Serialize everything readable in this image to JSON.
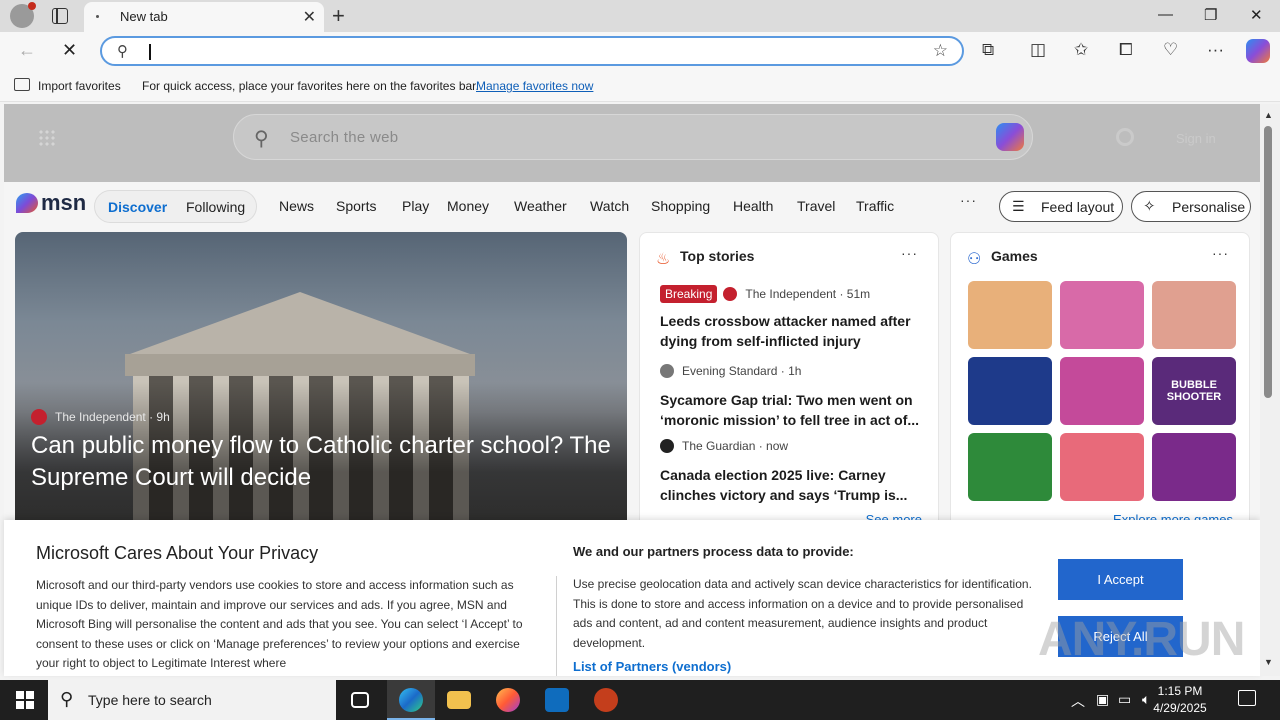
{
  "browser": {
    "tab_title": "New tab",
    "address_value": "",
    "favorites_bar": {
      "import_label": "Import favorites",
      "message": "For quick access, place your favorites here on the favorites bar.",
      "manage_link": "Manage favorites now"
    }
  },
  "msn": {
    "search_placeholder": "Search the web",
    "dim_sign_in": "Sign in",
    "logo_text": "msn",
    "pill": {
      "discover": "Discover",
      "following": "Following"
    },
    "nav_items": [
      "News",
      "Sports",
      "Play",
      "Money",
      "Weather",
      "Watch",
      "Shopping",
      "Health",
      "Travel",
      "Traffic"
    ],
    "more": "···",
    "feed_layout": "Feed layout",
    "personalise": "Personalise"
  },
  "hero": {
    "source": "The Independent · 9h",
    "title": "Can public money flow to Catholic charter school? The Supreme Court will decide"
  },
  "top_stories": {
    "heading": "Top stories",
    "stories": [
      {
        "badge": "Breaking",
        "source": "The Independent · 51m",
        "title": "Leeds crossbow attacker named after dying from self-inflicted injury",
        "logo_color": "#c4202e"
      },
      {
        "badge": "",
        "source": "Evening Standard · 1h",
        "title": "Sycamore Gap trial: Two men went on ‘moronic mission’ to fell tree in act of...",
        "logo_color": "#777777"
      },
      {
        "badge": "",
        "source": "The Guardian · now",
        "title": "Canada election 2025 live: Carney clinches victory and says ‘Trump is...",
        "logo_color": "#222222"
      }
    ],
    "see_more": "See more"
  },
  "games": {
    "heading": "Games",
    "explore": "Explore more games",
    "tiles": [
      {
        "label": "",
        "color": "#e8b07a"
      },
      {
        "label": "",
        "color": "#d86aa8"
      },
      {
        "label": "",
        "color": "#e0a090"
      },
      {
        "label": "",
        "color": "#1e3a8a"
      },
      {
        "label": "",
        "color": "#c44a9a"
      },
      {
        "label": "BUBBLE SHOOTER",
        "color": "#5a2a7a"
      },
      {
        "label": "",
        "color": "#2e8a3a"
      },
      {
        "label": "",
        "color": "#e86a7a"
      },
      {
        "label": "",
        "color": "#7a2a8a"
      }
    ]
  },
  "consent": {
    "title": "Microsoft Cares About Your Privacy",
    "body": "Microsoft and our third-party vendors use cookies to store and access information such as unique IDs to deliver, maintain and improve our services and ads. If you agree, MSN and Microsoft Bing will personalise the content and ads that you see. You can select ‘I Accept’ to consent to these uses or click on ‘Manage preferences’ to review your options and exercise your right to object to Legitimate Interest where",
    "right_title": "We and our partners process data to provide:",
    "right_body": "Use precise geolocation data and actively scan device characteristics for identification. This is done to store and access information on a device and to provide personalised ads and content, ad and content measurement, audience insights and product development.",
    "partners_link": "List of Partners (vendors)",
    "accept": "I Accept",
    "reject": "Reject All"
  },
  "watermark": "ANY.RUN",
  "taskbar": {
    "search_placeholder": "Type here to search",
    "time": "1:15 PM",
    "date": "4/29/2025"
  }
}
